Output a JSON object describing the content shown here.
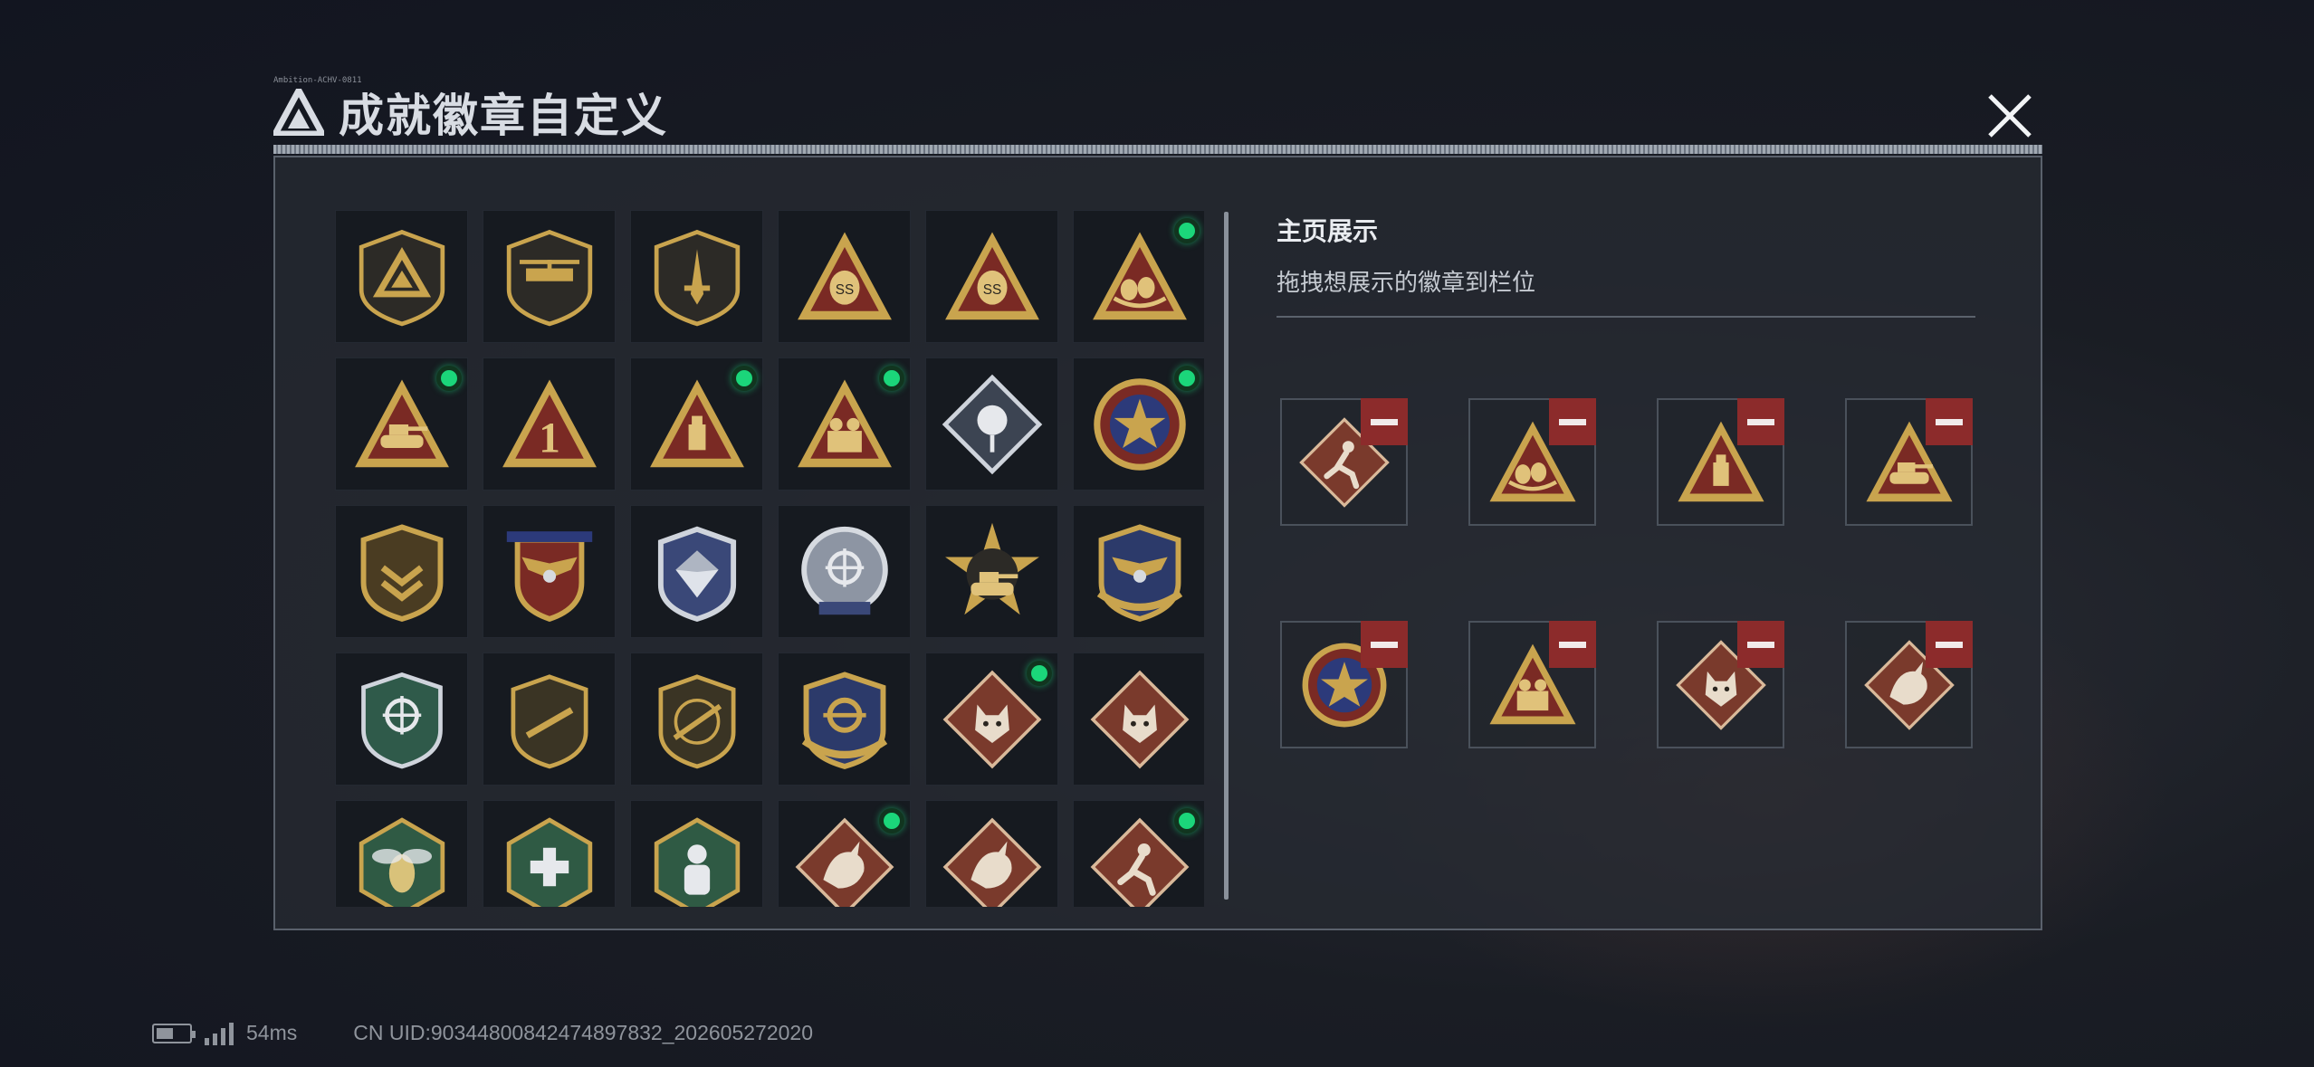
{
  "title": "成就徽章自定义",
  "title_tiny": "Ambition-ACHV-0811",
  "showcase": {
    "title": "主页展示",
    "subtitle": "拖拽想展示的徽章到栏位"
  },
  "colors": {
    "accent_green": "#1bd67a",
    "remove_red": "#8c2b2b",
    "gold": "#c9a44e",
    "badge_red": "#7a2a24"
  },
  "badges": [
    {
      "icon": "shield-delta-icon",
      "shape": "shield",
      "mark": "delta",
      "new": false
    },
    {
      "icon": "shield-helicopter-icon",
      "shape": "shield",
      "mark": "heli",
      "new": false
    },
    {
      "icon": "shield-dagger-icon",
      "shape": "shield",
      "mark": "dagger",
      "new": false
    },
    {
      "icon": "triangle-ss-bag-icon",
      "shape": "triangle",
      "mark": "SS",
      "new": false
    },
    {
      "icon": "triangle-ss-crate-icon",
      "shape": "triangle",
      "mark": "SS",
      "new": false
    },
    {
      "icon": "triangle-eggs-icon",
      "shape": "triangle",
      "mark": "eggs",
      "new": true
    },
    {
      "icon": "triangle-tank-icon",
      "shape": "triangle",
      "mark": "tank",
      "new": true
    },
    {
      "icon": "triangle-number-one-icon",
      "shape": "triangle",
      "mark": "1",
      "new": false
    },
    {
      "icon": "triangle-usb-icon",
      "shape": "triangle",
      "mark": "usb",
      "new": true
    },
    {
      "icon": "triangle-soldiers-icon",
      "shape": "triangle",
      "mark": "soldiers",
      "new": true
    },
    {
      "icon": "diamond-rose-icon",
      "shape": "diamond-steel",
      "mark": "rose",
      "new": false
    },
    {
      "icon": "round-star-medal-icon",
      "shape": "medal",
      "mark": "star",
      "new": true
    },
    {
      "icon": "shield-bronze-chevron-icon",
      "shape": "shield-gold",
      "mark": "chevron",
      "new": false
    },
    {
      "icon": "shield-red-wings-icon",
      "shape": "shield-red",
      "mark": "wings",
      "new": false
    },
    {
      "icon": "shield-silver-gem-icon",
      "shape": "shield-silver",
      "mark": "gem",
      "new": false
    },
    {
      "icon": "round-silver-target-icon",
      "shape": "round-silver",
      "mark": "target",
      "new": false
    },
    {
      "icon": "star-tank-icon",
      "shape": "star",
      "mark": "tank",
      "new": false
    },
    {
      "icon": "shield-navy-wings-icon",
      "shape": "shield-navy",
      "mark": "wings",
      "new": false
    },
    {
      "icon": "shield-green-target-icon",
      "shape": "shield-green",
      "mark": "target",
      "new": false
    },
    {
      "icon": "round-rifle-icon",
      "shape": "shield-olive",
      "mark": "rifle",
      "new": false
    },
    {
      "icon": "round-shotgun-icon",
      "shape": "shield-olive",
      "mark": "shotgun",
      "new": false
    },
    {
      "icon": "shield-navy-crosshair-icon",
      "shape": "shield-navy",
      "mark": "crosshair",
      "new": false
    },
    {
      "icon": "diamond-wolf-icon",
      "shape": "diamond-red",
      "mark": "wolf",
      "new": true
    },
    {
      "icon": "diamond-wolf-icon",
      "shape": "diamond-red",
      "mark": "wolf",
      "new": false
    },
    {
      "icon": "hexagon-wasp-icon",
      "shape": "hex-green",
      "mark": "wasp",
      "new": false
    },
    {
      "icon": "hexagon-medic-icon",
      "shape": "hex-green",
      "mark": "cross",
      "new": false
    },
    {
      "icon": "hexagon-soldier-icon",
      "shape": "hex-green",
      "mark": "soldier",
      "new": false
    },
    {
      "icon": "diamond-dragon-icon",
      "shape": "diamond-red",
      "mark": "dragon",
      "new": true
    },
    {
      "icon": "diamond-dragon-icon",
      "shape": "diamond-red",
      "mark": "dragon",
      "new": false
    },
    {
      "icon": "diamond-runner-icon",
      "shape": "diamond-red",
      "mark": "runner",
      "new": true
    }
  ],
  "slots": [
    {
      "icon": "diamond-runner-icon",
      "shape": "diamond-red",
      "mark": "runner"
    },
    {
      "icon": "triangle-eggs-icon",
      "shape": "triangle",
      "mark": "eggs"
    },
    {
      "icon": "triangle-usb-icon",
      "shape": "triangle",
      "mark": "usb"
    },
    {
      "icon": "triangle-tank-icon",
      "shape": "triangle",
      "mark": "tank"
    },
    {
      "icon": "round-star-medal-icon",
      "shape": "medal",
      "mark": "star"
    },
    {
      "icon": "triangle-soldiers-icon",
      "shape": "triangle",
      "mark": "soldiers"
    },
    {
      "icon": "diamond-wolf-icon",
      "shape": "diamond-red",
      "mark": "wolf"
    },
    {
      "icon": "diamond-dragon-icon",
      "shape": "diamond-red",
      "mark": "dragon"
    }
  ],
  "status": {
    "ping": "54ms",
    "uid": "CN UID:9034480084247489783​2_202605272020"
  }
}
